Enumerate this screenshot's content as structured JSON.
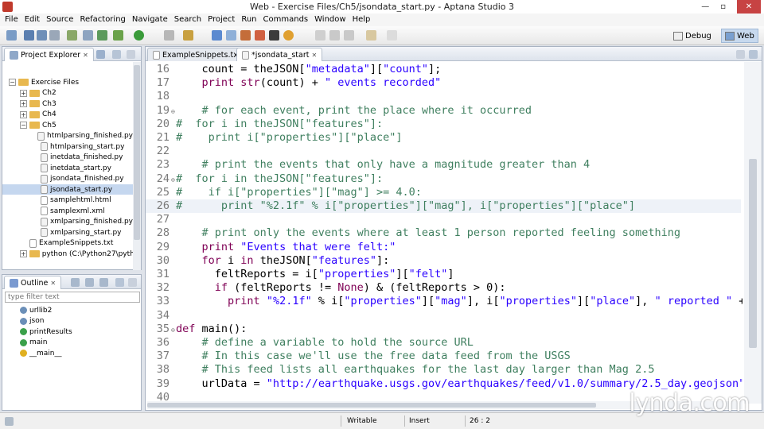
{
  "window": {
    "title": "Web - Exercise Files/Ch5/jsondata_start.py - Aptana Studio 3",
    "minimize": "—",
    "restore": "▫",
    "close": "✕"
  },
  "menu": [
    "File",
    "Edit",
    "Source",
    "Refactoring",
    "Navigate",
    "Search",
    "Project",
    "Run",
    "Commands",
    "Window",
    "Help"
  ],
  "perspectives": {
    "debug": "Debug",
    "web": "Web"
  },
  "project_explorer": {
    "tab": "Project Explorer",
    "items": [
      {
        "label": "Exercise Files",
        "type": "folder",
        "expanded": true
      },
      {
        "label": "Ch2",
        "type": "folder"
      },
      {
        "label": "Ch3",
        "type": "folder"
      },
      {
        "label": "Ch4",
        "type": "folder"
      },
      {
        "label": "Ch5",
        "type": "folder",
        "expanded": true
      },
      {
        "label": "htmlparsing_finished.py",
        "type": "py"
      },
      {
        "label": "htmlparsing_start.py",
        "type": "py"
      },
      {
        "label": "inetdata_finished.py",
        "type": "py"
      },
      {
        "label": "inetdata_start.py",
        "type": "py"
      },
      {
        "label": "jsondata_finished.py",
        "type": "py"
      },
      {
        "label": "jsondata_start.py",
        "type": "py",
        "selected": true
      },
      {
        "label": "samplehtml.html",
        "type": "html"
      },
      {
        "label": "samplexml.xml",
        "type": "xml"
      },
      {
        "label": "xmlparsing_finished.py",
        "type": "py"
      },
      {
        "label": "xmlparsing_start.py",
        "type": "py"
      },
      {
        "label": "ExampleSnippets.txt",
        "type": "txt"
      },
      {
        "label": "python  (C:\\Python27\\pytho",
        "type": "lib"
      }
    ]
  },
  "outline": {
    "tab": "Outline",
    "filter_placeholder": "type filter text",
    "items": [
      "urllib2",
      "json",
      "printResults",
      "main",
      "__main__"
    ]
  },
  "editor": {
    "tabs": [
      {
        "label": "ExampleSnippets.txt"
      },
      {
        "label": "*jsondata_start",
        "active": true
      }
    ],
    "lines": [
      {
        "n": "16",
        "t": "    count = theJSON[\"metadata\"][\"count\"];"
      },
      {
        "n": "17",
        "t": "    print str(count) + \" events recorded\""
      },
      {
        "n": "18",
        "t": ""
      },
      {
        "n": "19",
        "t": "    # for each event, print the place where it occurred",
        "k": "cm",
        "fold": true
      },
      {
        "n": "20",
        "t": "#  for i in theJSON[\"features\"]:",
        "k": "cm"
      },
      {
        "n": "21",
        "t": "#    print i[\"properties\"][\"place\"]",
        "k": "cm"
      },
      {
        "n": "22",
        "t": ""
      },
      {
        "n": "23",
        "t": "    # print the events that only have a magnitude greater than 4",
        "k": "cm"
      },
      {
        "n": "24",
        "t": "#  for i in theJSON[\"features\"]:",
        "k": "cm",
        "fold": true
      },
      {
        "n": "25",
        "t": "#    if i[\"properties\"][\"mag\"] >= 4.0:",
        "k": "cm"
      },
      {
        "n": "26",
        "t": "#      print \"%2.1f\" % i[\"properties\"][\"mag\"], i[\"properties\"][\"place\"]",
        "k": "cm",
        "cur": true
      },
      {
        "n": "27",
        "t": ""
      },
      {
        "n": "28",
        "t": "    # print only the events where at least 1 person reported feeling something",
        "k": "cm"
      },
      {
        "n": "29",
        "t": "    print \"Events that were felt:\""
      },
      {
        "n": "30",
        "t": "    for i in theJSON[\"features\"]:"
      },
      {
        "n": "31",
        "t": "      feltReports = i[\"properties\"][\"felt\"]"
      },
      {
        "n": "32",
        "t": "      if (feltReports != None) & (feltReports > 0):"
      },
      {
        "n": "33",
        "t": "        print \"%2.1f\" % i[\"properties\"][\"mag\"], i[\"properties\"][\"place\"], \" reported \" +"
      },
      {
        "n": "34",
        "t": ""
      },
      {
        "n": "35",
        "t": "def main():",
        "fold": true
      },
      {
        "n": "36",
        "t": "    # define a variable to hold the source URL",
        "k": "cm"
      },
      {
        "n": "37",
        "t": "    # In this case we'll use the free data feed from the USGS",
        "k": "cm"
      },
      {
        "n": "38",
        "t": "    # This feed lists all earthquakes for the last day larger than Mag 2.5",
        "k": "cm"
      },
      {
        "n": "39",
        "t": "    urlData = \"http://earthquake.usgs.gov/earthquakes/feed/v1.0/summary/2.5_day.geojson\""
      },
      {
        "n": "40",
        "t": ""
      }
    ]
  },
  "status": {
    "writable": "Writable",
    "insert": "Insert",
    "position": "26 : 2"
  },
  "watermark": "lynda.com",
  "colors": {
    "comment": "#3f7f5f",
    "string": "#2a00ff",
    "keyword": "#7f0055",
    "selection": "#c5d7ef"
  }
}
